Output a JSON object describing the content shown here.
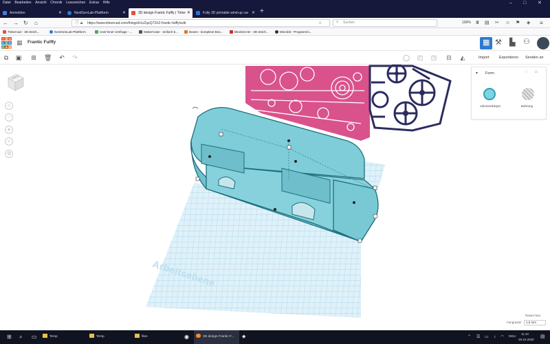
{
  "menubar": [
    "Datei",
    "Bearbeiten",
    "Ansicht",
    "Chronik",
    "Lesezeichen",
    "Extras",
    "Hilfe"
  ],
  "tabs": [
    {
      "label": "Anmelden",
      "color": "#4a79d8"
    },
    {
      "label": "NextGenLab-Plattform",
      "color": "#2b7ad0"
    },
    {
      "label": "3D design Frantic Fulffy | Tinke",
      "color": "#e44f3c",
      "active": true
    },
    {
      "label": "Fully 3D printable wind-up car",
      "color": "#2d6fd6"
    }
  ],
  "url": "https://www.tinkercad.com/things/b1zZqsQ73XZ-frantic-fulffy/edit",
  "search_placeholder": "Suchen",
  "zoom_level": "100%",
  "bookmarks": [
    {
      "label": "Tinkercad - 3D-Zeich...",
      "color": "#e44f3c"
    },
    {
      "label": "NextGenLab-Plattform",
      "color": "#2b7ad0"
    },
    {
      "label": "User'inner Umfrage - ...",
      "color": "#5aa05a"
    },
    {
      "label": "MakerCase - einfach b...",
      "color": "#555"
    },
    {
      "label": "Boxes - komplexe Box...",
      "color": "#d77a2a"
    },
    {
      "label": "BlocksCAD - 3D-Zeich...",
      "color": "#c03030"
    },
    {
      "label": "Microbit - Programmi...",
      "color": "#333"
    }
  ],
  "design_name": "Frantic Fulffy",
  "toolbar_right": {
    "import": "Import",
    "export": "Exportieren",
    "send": "Senden an"
  },
  "viewcube_label": "OBEN",
  "shape_panel": {
    "title": "Form",
    "solid_label": "Volumenkörper",
    "hole_label": "Bohrung"
  },
  "workplane_label": "Arbeitsebene",
  "bottom_right": {
    "edit_grid": "Raster bea",
    "snap_label": "Fangraster",
    "snap_value": "1,0 mm"
  },
  "taskbar": {
    "items": [
      {
        "label": "Temp"
      },
      {
        "label": "Temp"
      },
      {
        "label": "files"
      },
      {
        "label": "3D design Frantic F..."
      }
    ],
    "lang": "DEU",
    "time": "11:10",
    "date": "29.10.2020"
  },
  "colors": {
    "teal": "#7fcdd8",
    "teal_dark": "#1b6f7d",
    "pink": "#d9528c",
    "navy": "#2b2c5e",
    "grid": "#a8d8ec"
  }
}
